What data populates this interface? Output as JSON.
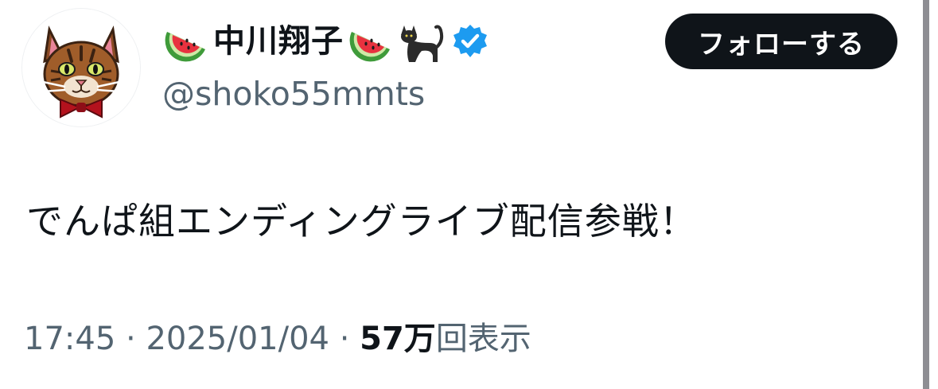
{
  "author": {
    "display_name": "中川翔子",
    "name_emojis": [
      "watermelon-icon",
      "watermelon-icon",
      "black-cat-icon"
    ],
    "verified": true,
    "handle": "@shoko55mmts"
  },
  "follow_button": {
    "label": "フォローする"
  },
  "tweet": {
    "text": "でんぱ組エンディングライブ配信参戦！",
    "time": "17:45",
    "separator": " · ",
    "date": "2025/01/04",
    "views_count": "57万",
    "views_label": "回表示"
  },
  "colors": {
    "text_primary": "#0f1419",
    "text_secondary": "#536471",
    "verified_blue": "#1d9bf0",
    "follow_button_bg": "#0f1419"
  }
}
